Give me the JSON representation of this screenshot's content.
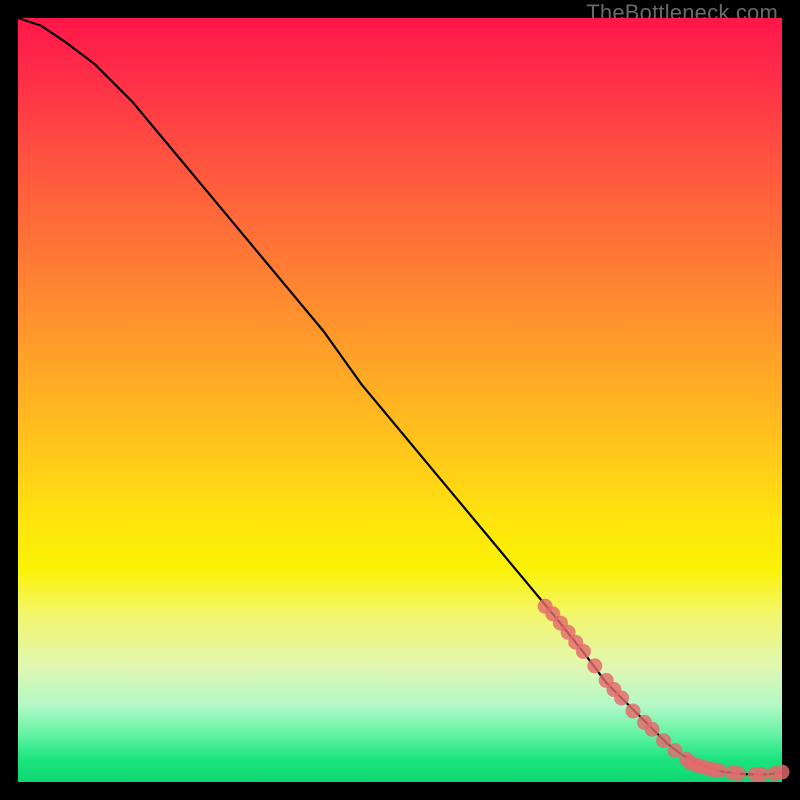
{
  "watermark": "TheBottleneck.com",
  "chart_data": {
    "type": "line",
    "title": "",
    "xlabel": "",
    "ylabel": "",
    "xlim": [
      0,
      100
    ],
    "ylim": [
      0,
      100
    ],
    "grid": false,
    "legend": false,
    "series": [
      {
        "name": "curve",
        "x": [
          0,
          3,
          6,
          10,
          15,
          20,
          25,
          30,
          35,
          40,
          45,
          50,
          55,
          60,
          65,
          70,
          74,
          77,
          80,
          83,
          85,
          87,
          89,
          90,
          92,
          94,
          96,
          98,
          100
        ],
        "y": [
          100,
          99,
          97,
          94,
          89,
          83,
          77,
          71,
          65,
          59,
          52,
          46,
          40,
          34,
          28,
          22,
          17,
          13,
          10,
          7,
          5,
          3.5,
          2.5,
          2.0,
          1.4,
          1.1,
          1.0,
          1.0,
          1.2
        ]
      }
    ],
    "markers": [
      {
        "x": 69.0,
        "y": 23.0
      },
      {
        "x": 70.0,
        "y": 22.0
      },
      {
        "x": 71.0,
        "y": 20.8
      },
      {
        "x": 72.0,
        "y": 19.6
      },
      {
        "x": 73.0,
        "y": 18.3
      },
      {
        "x": 74.0,
        "y": 17.1
      },
      {
        "x": 75.5,
        "y": 15.2
      },
      {
        "x": 77.0,
        "y": 13.3
      },
      {
        "x": 78.0,
        "y": 12.1
      },
      {
        "x": 79.0,
        "y": 11.0
      },
      {
        "x": 80.5,
        "y": 9.3
      },
      {
        "x": 82.0,
        "y": 7.8
      },
      {
        "x": 83.0,
        "y": 6.9
      },
      {
        "x": 84.5,
        "y": 5.4
      },
      {
        "x": 86.0,
        "y": 4.1
      },
      {
        "x": 87.5,
        "y": 3.0
      },
      {
        "x": 88.0,
        "y": 2.5
      },
      {
        "x": 88.8,
        "y": 2.2
      },
      {
        "x": 89.5,
        "y": 2.0
      },
      {
        "x": 90.3,
        "y": 1.8
      },
      {
        "x": 91.0,
        "y": 1.6
      },
      {
        "x": 91.8,
        "y": 1.5
      },
      {
        "x": 93.5,
        "y": 1.2
      },
      {
        "x": 94.3,
        "y": 1.1
      },
      {
        "x": 96.5,
        "y": 1.0
      },
      {
        "x": 97.3,
        "y": 1.0
      },
      {
        "x": 99.0,
        "y": 1.1
      },
      {
        "x": 100.0,
        "y": 1.3
      }
    ]
  }
}
